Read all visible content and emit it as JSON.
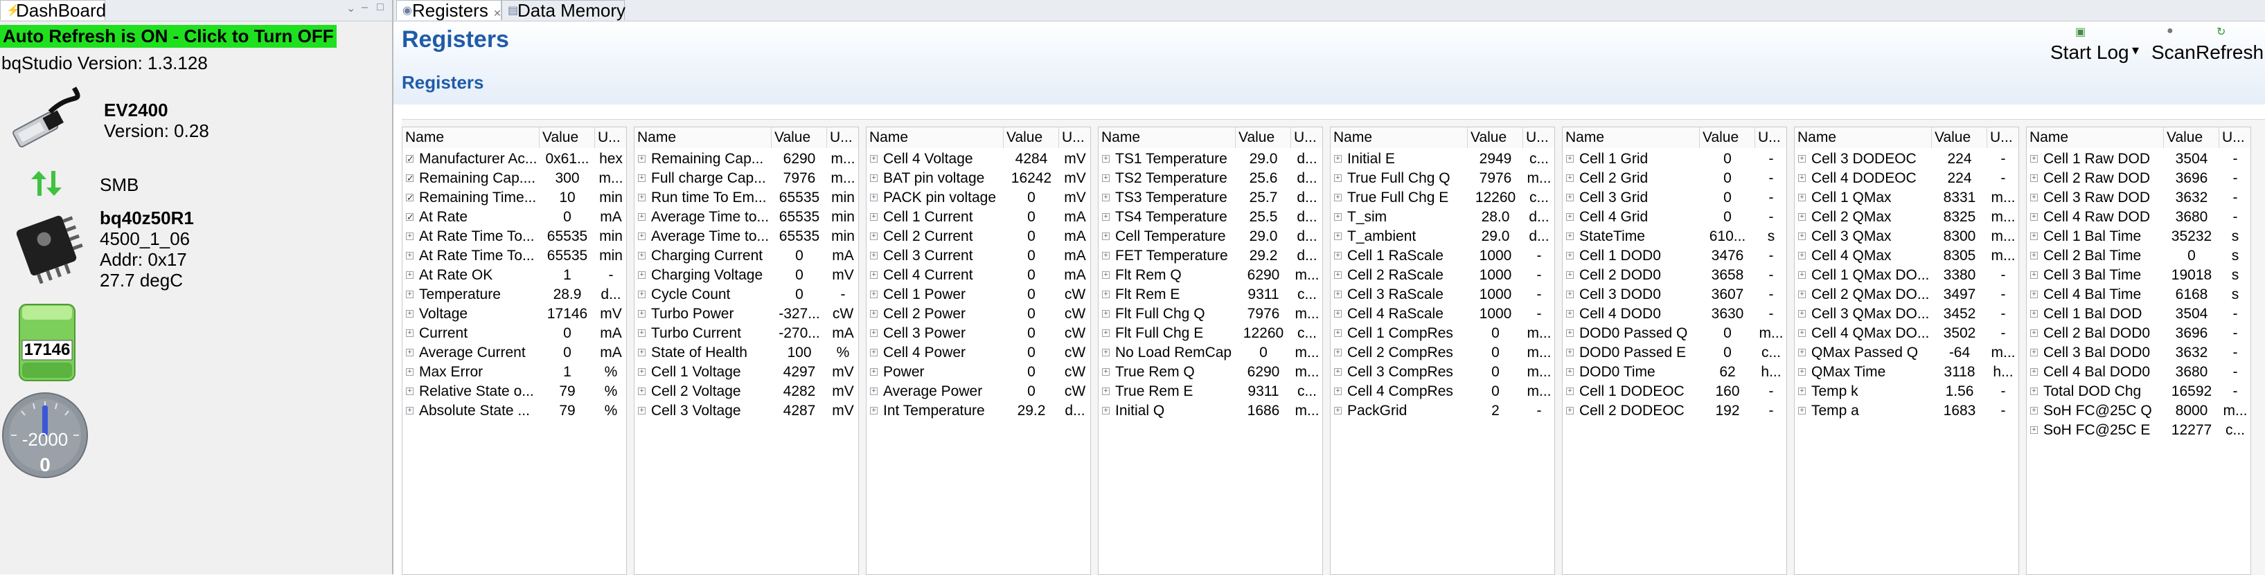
{
  "left_panel": {
    "tab": "DashBoard",
    "auto_refresh": "Auto Refresh is ON - Click to Turn OFF",
    "version": "bqStudio Version:  1.3.128",
    "ev_name": "EV2400",
    "ev_version": "Version: 0.28",
    "smb": "SMB",
    "device_name": "bq40z50R1",
    "device_fw": "4500_1_06",
    "device_addr": "Addr: 0x17",
    "device_temp": "27.7 degC",
    "battery_value": "17146",
    "gauge_scale": "-2000",
    "gauge_value": "0",
    "icons": [
      "usb-cable-icon",
      "double-arrow-icon",
      "chip-icon",
      "battery-icon",
      "gauge-icon"
    ],
    "highlight_color": "#1fe01f"
  },
  "tabs": [
    {
      "label": "Registers"
    },
    {
      "label": "Data Memory"
    }
  ],
  "header": {
    "title": "Registers",
    "section": "Registers",
    "start_log": "Start Log",
    "scan": "Scan",
    "refresh": "Refresh",
    "title_color": "#1f5ca8"
  },
  "columns": {
    "name": "Name",
    "value": "Value",
    "unit": "U..."
  },
  "tables": [
    {
      "rows": [
        {
          "name": "Manufacturer Ac...",
          "value": "0x61...",
          "unit": "hex",
          "check": true
        },
        {
          "name": "Remaining Cap....",
          "value": "300",
          "unit": "m...",
          "check": true
        },
        {
          "name": "Remaining Time...",
          "value": "10",
          "unit": "min",
          "check": true
        },
        {
          "name": "At Rate",
          "value": "0",
          "unit": "mA",
          "check": true
        },
        {
          "name": "At Rate Time To...",
          "value": "65535",
          "unit": "min"
        },
        {
          "name": "At Rate Time To...",
          "value": "65535",
          "unit": "min"
        },
        {
          "name": "At Rate OK",
          "value": "1",
          "unit": "-"
        },
        {
          "name": "Temperature",
          "value": "28.9",
          "unit": "d..."
        },
        {
          "name": "Voltage",
          "value": "17146",
          "unit": "mV"
        },
        {
          "name": "Current",
          "value": "0",
          "unit": "mA"
        },
        {
          "name": "Average Current",
          "value": "0",
          "unit": "mA"
        },
        {
          "name": "Max Error",
          "value": "1",
          "unit": "%"
        },
        {
          "name": "Relative State o...",
          "value": "79",
          "unit": "%"
        },
        {
          "name": "Absolute State ...",
          "value": "79",
          "unit": "%"
        }
      ]
    },
    {
      "rows": [
        {
          "name": "Remaining Cap...",
          "value": "6290",
          "unit": "m..."
        },
        {
          "name": "Full charge Cap...",
          "value": "7976",
          "unit": "m..."
        },
        {
          "name": "Run time To Em...",
          "value": "65535",
          "unit": "min"
        },
        {
          "name": "Average Time to...",
          "value": "65535",
          "unit": "min"
        },
        {
          "name": "Average Time to...",
          "value": "65535",
          "unit": "min"
        },
        {
          "name": "Charging Current",
          "value": "0",
          "unit": "mA"
        },
        {
          "name": "Charging Voltage",
          "value": "0",
          "unit": "mV"
        },
        {
          "name": "Cycle Count",
          "value": "0",
          "unit": "-"
        },
        {
          "name": "Turbo Power",
          "value": "-327...",
          "unit": "cW"
        },
        {
          "name": "Turbo Current",
          "value": "-270...",
          "unit": "mA"
        },
        {
          "name": "State of Health",
          "value": "100",
          "unit": "%"
        },
        {
          "name": "Cell 1 Voltage",
          "value": "4297",
          "unit": "mV"
        },
        {
          "name": "Cell 2 Voltage",
          "value": "4282",
          "unit": "mV"
        },
        {
          "name": "Cell 3 Voltage",
          "value": "4287",
          "unit": "mV"
        }
      ]
    },
    {
      "rows": [
        {
          "name": "Cell 4 Voltage",
          "value": "4284",
          "unit": "mV"
        },
        {
          "name": "BAT pin voltage",
          "value": "16242",
          "unit": "mV"
        },
        {
          "name": "PACK pin voltage",
          "value": "0",
          "unit": "mV"
        },
        {
          "name": "Cell 1 Current",
          "value": "0",
          "unit": "mA"
        },
        {
          "name": "Cell 2 Current",
          "value": "0",
          "unit": "mA"
        },
        {
          "name": "Cell 3 Current",
          "value": "0",
          "unit": "mA"
        },
        {
          "name": "Cell 4 Current",
          "value": "0",
          "unit": "mA"
        },
        {
          "name": "Cell 1 Power",
          "value": "0",
          "unit": "cW"
        },
        {
          "name": "Cell 2 Power",
          "value": "0",
          "unit": "cW"
        },
        {
          "name": "Cell 3 Power",
          "value": "0",
          "unit": "cW"
        },
        {
          "name": "Cell 4 Power",
          "value": "0",
          "unit": "cW"
        },
        {
          "name": "Power",
          "value": "0",
          "unit": "cW"
        },
        {
          "name": "Average Power",
          "value": "0",
          "unit": "cW"
        },
        {
          "name": "Int Temperature",
          "value": "29.2",
          "unit": "d..."
        }
      ]
    },
    {
      "rows": [
        {
          "name": "TS1 Temperature",
          "value": "29.0",
          "unit": "d..."
        },
        {
          "name": "TS2 Temperature",
          "value": "25.6",
          "unit": "d..."
        },
        {
          "name": "TS3 Temperature",
          "value": "25.7",
          "unit": "d..."
        },
        {
          "name": "TS4 Temperature",
          "value": "25.5",
          "unit": "d..."
        },
        {
          "name": "Cell Temperature",
          "value": "29.0",
          "unit": "d..."
        },
        {
          "name": "FET Temperature",
          "value": "29.2",
          "unit": "d..."
        },
        {
          "name": "Flt Rem Q",
          "value": "6290",
          "unit": "m..."
        },
        {
          "name": "Flt Rem E",
          "value": "9311",
          "unit": "c..."
        },
        {
          "name": "Flt Full Chg Q",
          "value": "7976",
          "unit": "m..."
        },
        {
          "name": "Flt Full Chg E",
          "value": "12260",
          "unit": "c..."
        },
        {
          "name": "No Load RemCap",
          "value": "0",
          "unit": "m..."
        },
        {
          "name": "True Rem Q",
          "value": "6290",
          "unit": "m..."
        },
        {
          "name": "True Rem E",
          "value": "9311",
          "unit": "c..."
        },
        {
          "name": "Initial Q",
          "value": "1686",
          "unit": "m..."
        }
      ]
    },
    {
      "rows": [
        {
          "name": "Initial E",
          "value": "2949",
          "unit": "c..."
        },
        {
          "name": "True Full Chg Q",
          "value": "7976",
          "unit": "m..."
        },
        {
          "name": "True Full Chg E",
          "value": "12260",
          "unit": "c..."
        },
        {
          "name": "T_sim",
          "value": "28.0",
          "unit": "d..."
        },
        {
          "name": "T_ambient",
          "value": "29.0",
          "unit": "d..."
        },
        {
          "name": "Cell 1 RaScale",
          "value": "1000",
          "unit": "-"
        },
        {
          "name": "Cell 2 RaScale",
          "value": "1000",
          "unit": "-"
        },
        {
          "name": "Cell 3 RaScale",
          "value": "1000",
          "unit": "-"
        },
        {
          "name": "Cell 4 RaScale",
          "value": "1000",
          "unit": "-"
        },
        {
          "name": "Cell 1 CompRes",
          "value": "0",
          "unit": "m..."
        },
        {
          "name": "Cell 2 CompRes",
          "value": "0",
          "unit": "m..."
        },
        {
          "name": "Cell 3 CompRes",
          "value": "0",
          "unit": "m..."
        },
        {
          "name": "Cell 4 CompRes",
          "value": "0",
          "unit": "m..."
        },
        {
          "name": "PackGrid",
          "value": "2",
          "unit": "-"
        }
      ]
    },
    {
      "rows": [
        {
          "name": "Cell 1 Grid",
          "value": "0",
          "unit": "-"
        },
        {
          "name": "Cell 2 Grid",
          "value": "0",
          "unit": "-"
        },
        {
          "name": "Cell 3 Grid",
          "value": "0",
          "unit": "-"
        },
        {
          "name": "Cell 4 Grid",
          "value": "0",
          "unit": "-"
        },
        {
          "name": "StateTime",
          "value": "610...",
          "unit": "s"
        },
        {
          "name": "Cell 1 DOD0",
          "value": "3476",
          "unit": "-"
        },
        {
          "name": "Cell 2 DOD0",
          "value": "3658",
          "unit": "-"
        },
        {
          "name": "Cell 3 DOD0",
          "value": "3607",
          "unit": "-"
        },
        {
          "name": "Cell 4 DOD0",
          "value": "3630",
          "unit": "-"
        },
        {
          "name": "DOD0 Passed Q",
          "value": "0",
          "unit": "m..."
        },
        {
          "name": "DOD0 Passed E",
          "value": "0",
          "unit": "c..."
        },
        {
          "name": "DOD0 Time",
          "value": "62",
          "unit": "h..."
        },
        {
          "name": "Cell 1 DODEOC",
          "value": "160",
          "unit": "-"
        },
        {
          "name": "Cell 2 DODEOC",
          "value": "192",
          "unit": "-"
        }
      ]
    },
    {
      "rows": [
        {
          "name": "Cell 3 DODEOC",
          "value": "224",
          "unit": "-"
        },
        {
          "name": "Cell 4 DODEOC",
          "value": "224",
          "unit": "-"
        },
        {
          "name": "Cell 1 QMax",
          "value": "8331",
          "unit": "m..."
        },
        {
          "name": "Cell 2 QMax",
          "value": "8325",
          "unit": "m..."
        },
        {
          "name": "Cell 3 QMax",
          "value": "8300",
          "unit": "m..."
        },
        {
          "name": "Cell 4 QMax",
          "value": "8305",
          "unit": "m..."
        },
        {
          "name": "Cell 1 QMax DO...",
          "value": "3380",
          "unit": "-"
        },
        {
          "name": "Cell 2 QMax DO...",
          "value": "3497",
          "unit": "-"
        },
        {
          "name": "Cell 3 QMax DO...",
          "value": "3452",
          "unit": "-"
        },
        {
          "name": "Cell 4 QMax DO...",
          "value": "3502",
          "unit": "-"
        },
        {
          "name": "QMax Passed Q",
          "value": "-64",
          "unit": "m..."
        },
        {
          "name": "QMax Time",
          "value": "3118",
          "unit": "h..."
        },
        {
          "name": "Temp k",
          "value": "1.56",
          "unit": "-"
        },
        {
          "name": "Temp a",
          "value": "1683",
          "unit": "-"
        }
      ]
    },
    {
      "rows": [
        {
          "name": "Cell 1 Raw DOD",
          "value": "3504",
          "unit": "-"
        },
        {
          "name": "Cell 2 Raw DOD",
          "value": "3696",
          "unit": "-"
        },
        {
          "name": "Cell 3 Raw DOD",
          "value": "3632",
          "unit": "-"
        },
        {
          "name": "Cell 4 Raw DOD",
          "value": "3680",
          "unit": "-"
        },
        {
          "name": "Cell 1 Bal Time",
          "value": "35232",
          "unit": "s"
        },
        {
          "name": "Cell 2 Bal Time",
          "value": "0",
          "unit": "s"
        },
        {
          "name": "Cell 3 Bal Time",
          "value": "19018",
          "unit": "s"
        },
        {
          "name": "Cell 4 Bal Time",
          "value": "6168",
          "unit": "s"
        },
        {
          "name": "Cell 1 Bal DOD",
          "value": "3504",
          "unit": "-"
        },
        {
          "name": "Cell 2 Bal DOD0",
          "value": "3696",
          "unit": "-"
        },
        {
          "name": "Cell 3 Bal DOD0",
          "value": "3632",
          "unit": "-"
        },
        {
          "name": "Cell 4 Bal DOD0",
          "value": "3680",
          "unit": "-"
        },
        {
          "name": "Total DOD Chg",
          "value": "16592",
          "unit": "-"
        },
        {
          "name": "SoH FC@25C Q",
          "value": "8000",
          "unit": "m..."
        },
        {
          "name": "SoH FC@25C E",
          "value": "12277",
          "unit": "c..."
        }
      ]
    }
  ]
}
